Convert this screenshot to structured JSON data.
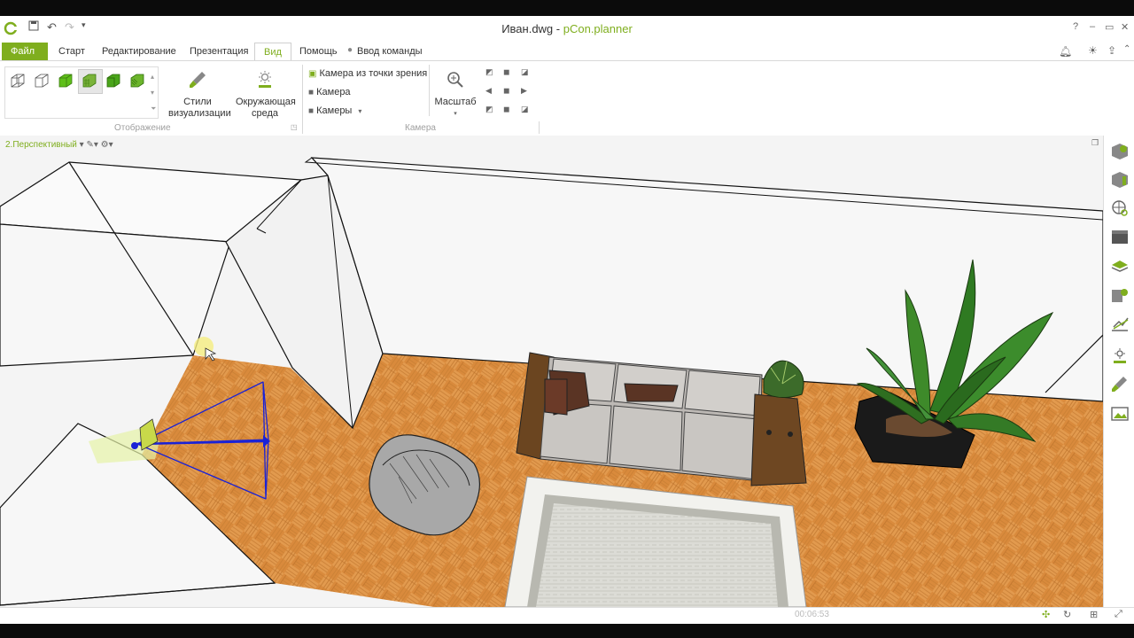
{
  "window": {
    "file_name": "Иван.dwg",
    "separator": " - ",
    "app_name": "pCon.planner",
    "help": "?",
    "controls": [
      "–",
      "▭",
      "✕"
    ]
  },
  "quick_access": [
    "save-icon",
    "undo-icon",
    "redo-icon",
    "customize-icon"
  ],
  "tabs": [
    {
      "label": "Файл"
    },
    {
      "label": "Старт"
    },
    {
      "label": "Редактирование"
    },
    {
      "label": "Презентация"
    },
    {
      "label": "Вид"
    },
    {
      "label": "Помощь"
    },
    {
      "label": "Ввод команды"
    }
  ],
  "ribbon": {
    "groups": {
      "display": "Отображение",
      "camera": "Камера"
    },
    "styles_btn": "Стили визуализации",
    "env_btn": "Окружающая среда",
    "camera_from_view": "Камера из точки зрения",
    "camera": "Камера",
    "cameras": "Камеры",
    "zoom": "Масштаб"
  },
  "viewport": {
    "label": "2.Перспективный"
  },
  "status": {
    "time": "00:06:53"
  },
  "colors": {
    "accent": "#7fae1e",
    "floor": "#d98a3c",
    "wall": "#f7f7f7",
    "camera_frustum": "#1a22d6"
  }
}
